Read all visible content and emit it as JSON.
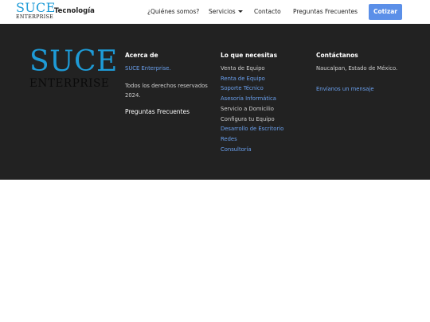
{
  "header": {
    "logo_main": "SUCE",
    "logo_sub": "ENTERPRISE",
    "tagline": "Tecnología",
    "nav": {
      "about": "¿Quiénes somos?",
      "services": "Servicios",
      "contact": "Contacto",
      "faq": "Preguntas Frecuentes"
    },
    "cta": "Cotizar"
  },
  "footer": {
    "logo_main": "SUCE",
    "logo_sub": "ENTERPRISE",
    "about": {
      "title": "Acerca de",
      "company_link": "SUCE Enterprise.",
      "rights_1": "Todos los derechos reservados",
      "rights_2": "2024.",
      "faq_link": "Preguntas Frecuentes"
    },
    "needs": {
      "title": "Lo que necesitas",
      "items": [
        "Venta de Equipo",
        "Renta de Equipo",
        "Soporte Técnico",
        "Asesoría Informática",
        "Servicio a Domicilio",
        "Configura tu Equipo",
        "Desarrollo de Escritorio",
        "Redes",
        "Consultoría"
      ]
    },
    "contact": {
      "title": "Contáctanos",
      "location": "Naucalpan, Estado de México.",
      "message_link": "Envíanos un mensaje"
    }
  },
  "colors": {
    "accent": "#5b8fe8",
    "brand_blue": "#1e9bd7",
    "footer_bg": "#222222",
    "link": "#6aa0ee"
  }
}
